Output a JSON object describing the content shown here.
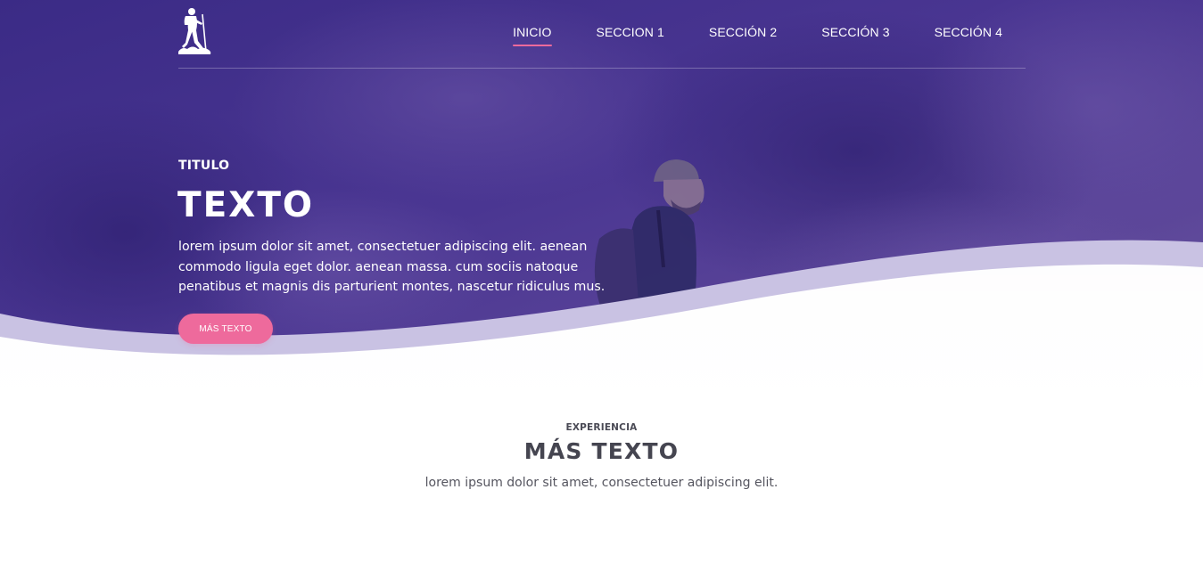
{
  "theme": {
    "hero_overlay": "#3a2a85",
    "accent": "#ee6a9c",
    "wave_light": "#c9c2e3"
  },
  "header": {
    "logo_icon": "hiker-icon",
    "nav": [
      {
        "label": "INICIO",
        "active": true
      },
      {
        "label": "SECCION 1",
        "active": false
      },
      {
        "label": "SECCIÓN 2",
        "active": false
      },
      {
        "label": "SECCIÓN 3",
        "active": false
      },
      {
        "label": "SECCIÓN 4",
        "active": false
      }
    ]
  },
  "hero": {
    "eyebrow": "TITULO",
    "title": "TEXTO",
    "body": "lorem ipsum dolor sit amet, consectetuer adipiscing elit. aenean commodo ligula eget dolor. aenean massa. cum sociis natoque penatibus et magnis dis parturient montes, nascetur ridiculus mus.",
    "button_label": "MÁS TEXTO"
  },
  "section": {
    "eyebrow": "EXPERIENCIA",
    "title": "MÁS TEXTO",
    "body": "lorem ipsum dolor sit amet, consectetuer adipiscing elit."
  }
}
